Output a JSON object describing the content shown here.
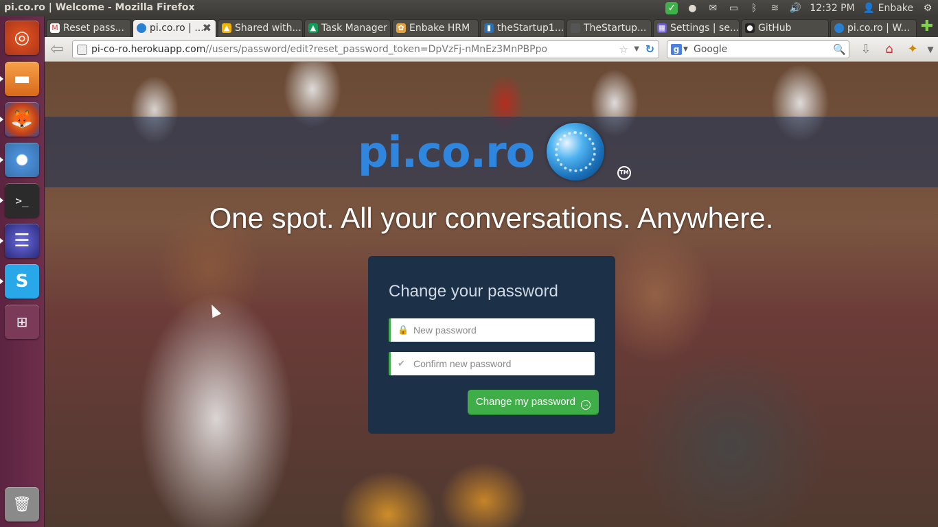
{
  "window": {
    "title": "pi.co.ro | Welcome - Mozilla Firefox"
  },
  "tray": {
    "time": "12:32 PM",
    "user": "Enbake"
  },
  "tabs": [
    {
      "label": "Reset pass...",
      "icon": "gmail-icon"
    },
    {
      "label": "pi.co.ro | ...",
      "icon": "picoro-icon",
      "active": true
    },
    {
      "label": "Shared with...",
      "icon": "drive-icon"
    },
    {
      "label": "Task Manager",
      "icon": "drive-icon"
    },
    {
      "label": "Enbake HRM",
      "icon": "hrm-icon"
    },
    {
      "label": "theStartup1...",
      "icon": "trello-icon"
    },
    {
      "label": "TheStartup...",
      "icon": "page-icon"
    },
    {
      "label": "Settings | se...",
      "icon": "settings-icon"
    },
    {
      "label": "GitHub",
      "icon": "github-icon"
    },
    {
      "label": "pi.co.ro | W...",
      "icon": "picoro-icon"
    }
  ],
  "navbar": {
    "url_host": "pi-co-ro.herokuapp.com",
    "url_path": "//users/password/edit?reset_password_token=DpVzFj-nMnEz3MnPBPpo",
    "search_placeholder": "Google"
  },
  "page": {
    "logo_text": "pi.co.ro",
    "tm": "TM",
    "tagline": "One spot. All your conversations. Anywhere.",
    "form": {
      "title": "Change your password",
      "new_password_placeholder": "New password",
      "confirm_password_placeholder": "Confirm new password",
      "submit_label": "Change my password"
    }
  },
  "colors": {
    "accent_green": "#3fae49",
    "card_bg": "#1c3048",
    "launcher": "#5b2440"
  }
}
